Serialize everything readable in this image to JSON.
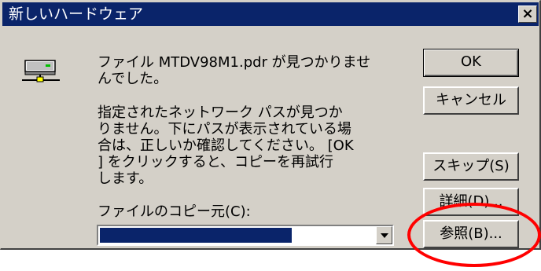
{
  "window": {
    "title": "新しいハードウェア",
    "close_label": "×"
  },
  "message": {
    "line1": "ファイル MTDV98M1.pdr が見つかりませ\nんでした。",
    "line2": "指定されたネットワーク パスが見つか\nりません。下にパスが表示されている場\n合は、正しいか確認してください。 [OK\n] をクリックすると、コピーを再試行\nします。"
  },
  "copy_source": {
    "label": "ファイルのコピー元(C):",
    "selected_value": ""
  },
  "buttons": {
    "ok": "OK",
    "cancel": "キャンセル",
    "skip": "スキップ(S)",
    "details": "詳細(D)...",
    "browse": "参照(B)..."
  },
  "icons": {
    "device": "network-device-icon",
    "dropdown": "chevron-down-icon"
  },
  "colors": {
    "title_bar": "#0a246a",
    "highlight": "#ff0000",
    "face": "#d4d0c8"
  }
}
